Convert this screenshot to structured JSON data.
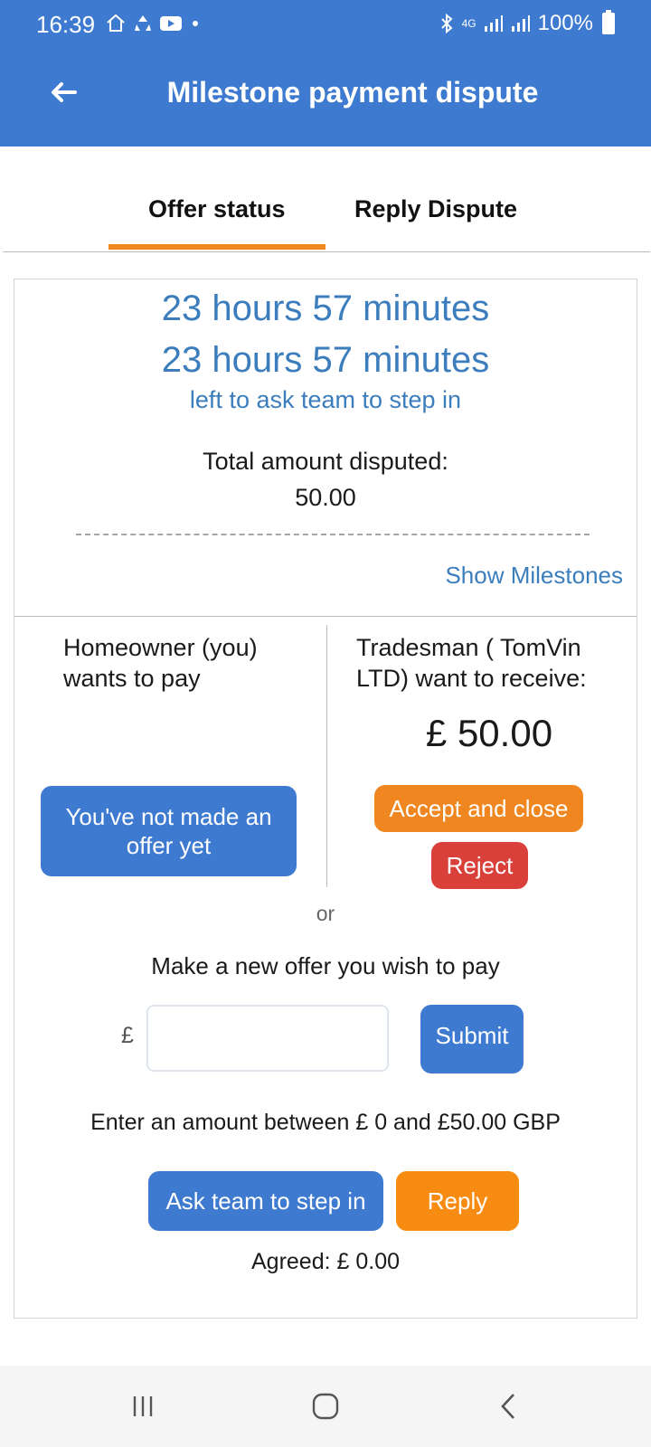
{
  "status_bar": {
    "time": "16:39",
    "network": "4G",
    "battery": "100%"
  },
  "header": {
    "title": "Milestone payment dispute"
  },
  "tabs": [
    {
      "label": "Offer status",
      "active": true
    },
    {
      "label": "Reply Dispute",
      "active": false
    }
  ],
  "timer": {
    "line1": "23 hours 57 minutes",
    "line2": "23 hours 57 minutes",
    "subtitle": "left to ask team to step in"
  },
  "dispute": {
    "total_label": "Total amount disputed:",
    "total_value": "50.00",
    "show_milestones": "Show Milestones"
  },
  "homeowner": {
    "line1": "Homeowner (you)",
    "line2": "wants to pay",
    "offer_button": "You've not made an offer yet"
  },
  "tradesman": {
    "line1": "Tradesman ( TomVin",
    "line2": "LTD) want to receive:",
    "amount": "£ 50.00",
    "accept_button": "Accept and close",
    "reject_button": "Reject"
  },
  "offer_form": {
    "or_text": "or",
    "prompt": "Make a new offer you wish to pay",
    "currency_symbol": "£",
    "input_value": "",
    "submit_button": "Submit",
    "range_hint": "Enter an amount between £ 0 and £50.00 GBP"
  },
  "actions": {
    "ask_team_button": "Ask team to step in",
    "reply_button": "Reply"
  },
  "agreed": "Agreed: £ 0.00",
  "colors": {
    "primary_blue": "#3d7ad0",
    "link_blue": "#3c7dbd",
    "accent_orange": "#f0861f",
    "reject_red": "#d9403a"
  }
}
